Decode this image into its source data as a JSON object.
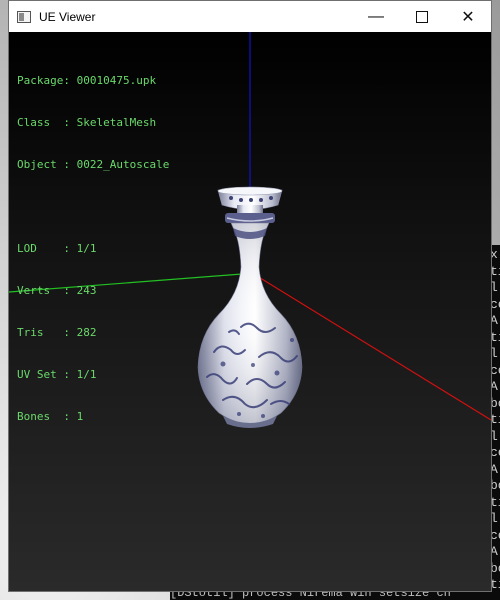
{
  "window": {
    "title": "UE Viewer",
    "controls": {
      "minimize": "—",
      "close": "✕"
    }
  },
  "info": {
    "package": {
      "label": "Package",
      "value": "00010475.upk"
    },
    "class": {
      "label": "Class",
      "value": "SkeletalMesh"
    },
    "object": {
      "label": "Object",
      "value": "0022_Autoscale"
    },
    "lod": {
      "label": "LOD",
      "value": "1/1"
    },
    "verts": {
      "label": "Verts",
      "value": "243"
    },
    "tris": {
      "label": "Tris",
      "value": "282"
    },
    "uvset": {
      "label": "UV Set",
      "value": "1/1"
    },
    "bones": {
      "label": "Bones",
      "value": "1"
    }
  },
  "console": {
    "right_column": [
      "x",
      "ti",
      "l",
      "ce",
      "A",
      "ti",
      "l",
      "ce",
      "A",
      "bo",
      "ti",
      "l",
      "ce",
      "A",
      "bo",
      "ti",
      "l",
      "ce",
      "A",
      "bo",
      "ti"
    ],
    "bottom_line": "[DStotil] process  Nirema win setsize  ch"
  },
  "colors": {
    "info_text": "#6bd96b",
    "axis_x": "#d01010",
    "axis_y": "#22c022",
    "axis_z": "#1414c8"
  }
}
